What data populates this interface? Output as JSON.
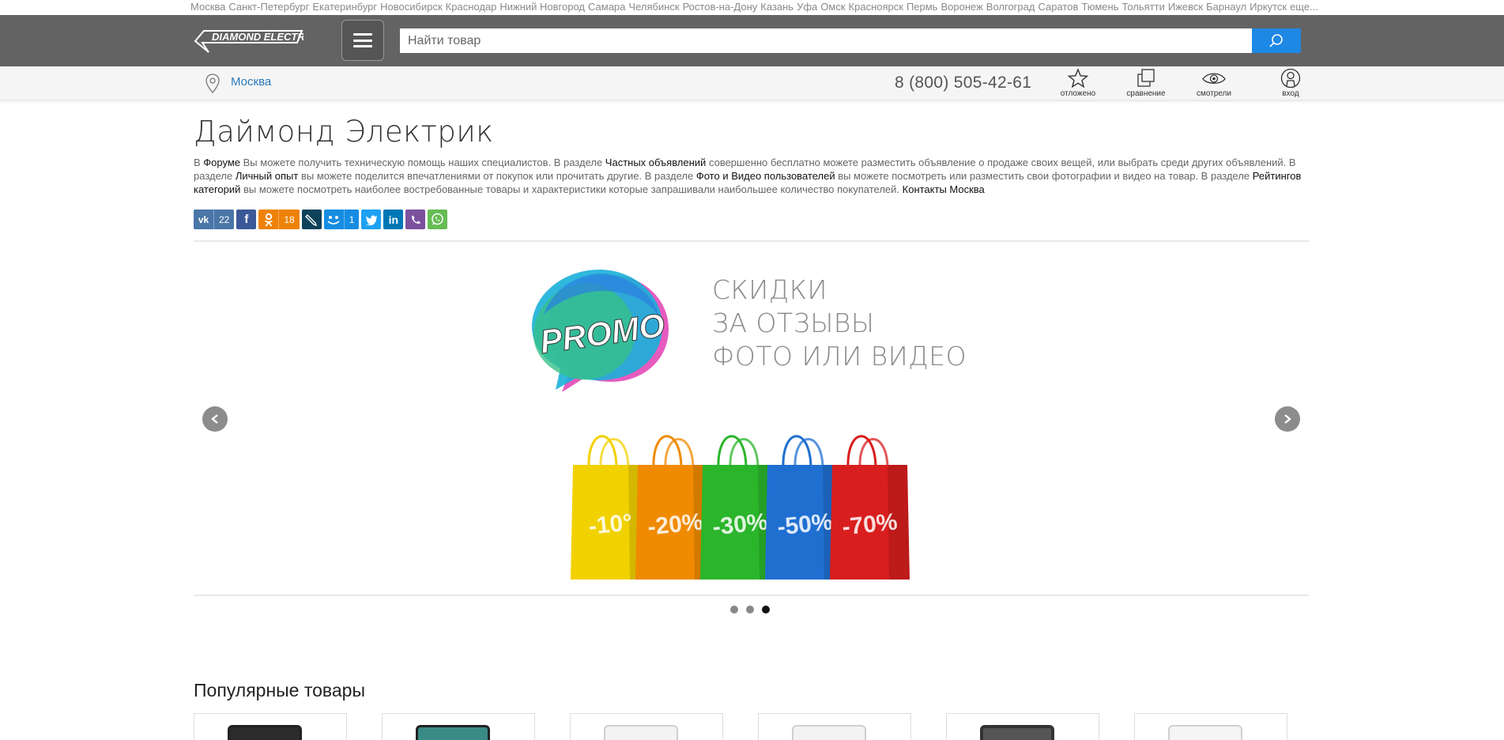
{
  "cities": [
    "Москва",
    "Санкт-Петербург",
    "Екатеринбург",
    "Новосибирск",
    "Краснодар",
    "Нижний Новгород",
    "Самара",
    "Челябинск",
    "Ростов-на-Дону",
    "Казань",
    "Уфа",
    "Омск",
    "Красноярск",
    "Пермь",
    "Воронеж",
    "Волгоград",
    "Саратов",
    "Тюмень",
    "Тольятти",
    "Ижевск",
    "Барнаул",
    "Иркутск",
    "еще..."
  ],
  "header": {
    "logo_text": "DIAMOND ELECTRIC",
    "search_placeholder": "Найти товар"
  },
  "subbar": {
    "city": "Москва",
    "phone": "8 (800) 505-42-61",
    "tools": {
      "saved": "отложено",
      "compare": "сравнение",
      "viewed": "смотрели",
      "login": "вход"
    }
  },
  "page": {
    "title": "Даймонд Электрик",
    "intro": {
      "t1": "В ",
      "l1": "Форуме",
      "t2": " Вы можете получить техническую помощь наших специалистов. В разделе ",
      "l2": "Частных объявлений",
      "t3": " совершенно бесплатно можете разместить объявление о продаже своих вещей, или выбрать среди других объявлений. В разделе ",
      "l3": "Личный опыт",
      "t4": " вы можете поделится впечатлениями от покупок или прочитать другие. В разделе ",
      "l4": "Фото и Видео пользователей",
      "t5": " вы можете посмотреть или разместить свои фотографии и видео на товар. В разделе ",
      "l5": "Рейтингов категорий",
      "t6": " вы можете посмотреть наиболее востребованные товары и характеристики которые запрашивали наибольшее количество покупателей. ",
      "l6": "Контакты Москва"
    }
  },
  "share": {
    "vk_count": "22",
    "ok_count": "18",
    "mm_count": "1",
    "colors": {
      "vk": "#4a76a8",
      "fb": "#3b5998",
      "ok": "#ee8208",
      "lj": "#0d425a",
      "mm": "#168de2",
      "tw": "#1da1f2",
      "li": "#0077b5",
      "viber": "#7b519d",
      "whatsapp": "#65bc54"
    }
  },
  "slider": {
    "badge": "PROMO",
    "lines": [
      "СКИДКИ",
      "ЗА ОТЗЫВЫ",
      "ФОТО ИЛИ ВИДЕО"
    ],
    "bags": [
      {
        "label": "-10°",
        "color": "#f2d100"
      },
      {
        "label": "-20%",
        "color": "#f08a00"
      },
      {
        "label": "-30%",
        "color": "#2bb52b"
      },
      {
        "label": "-50%",
        "color": "#1f6fd1"
      },
      {
        "label": "-70%",
        "color": "#d81e1e"
      }
    ],
    "active_slide": 3,
    "slide_count": 3
  },
  "popular": {
    "title": "Популярные товары"
  }
}
